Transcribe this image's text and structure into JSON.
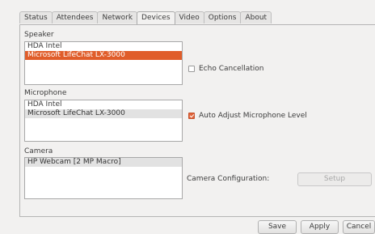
{
  "tabs": [
    {
      "label": "Status"
    },
    {
      "label": "Attendees"
    },
    {
      "label": "Network"
    },
    {
      "label": "Devices"
    },
    {
      "label": "Video"
    },
    {
      "label": "Options"
    },
    {
      "label": "About"
    }
  ],
  "active_tab": "Devices",
  "speaker": {
    "label": "Speaker",
    "items": [
      "HDA Intel",
      "Microsoft LifeChat LX-3000"
    ],
    "selected": "Microsoft LifeChat LX-3000"
  },
  "echo_cancellation": {
    "label": "Echo Cancellation",
    "checked": false
  },
  "microphone": {
    "label": "Microphone",
    "items": [
      "HDA Intel",
      "Microsoft LifeChat LX-3000"
    ],
    "selected": "Microsoft LifeChat LX-3000"
  },
  "auto_adjust": {
    "label": "Auto Adjust Microphone Level",
    "checked": true
  },
  "camera": {
    "label": "Camera",
    "items": [
      "HP Webcam [2 MP Macro]"
    ],
    "selected": "HP Webcam [2 MP Macro]"
  },
  "camera_config": {
    "label": "Camera Configuration:",
    "setup_label": "Setup"
  },
  "buttons": {
    "save": "Save",
    "apply": "Apply",
    "cancel": "Cancel"
  },
  "colors": {
    "accent": "#e05d2a"
  }
}
